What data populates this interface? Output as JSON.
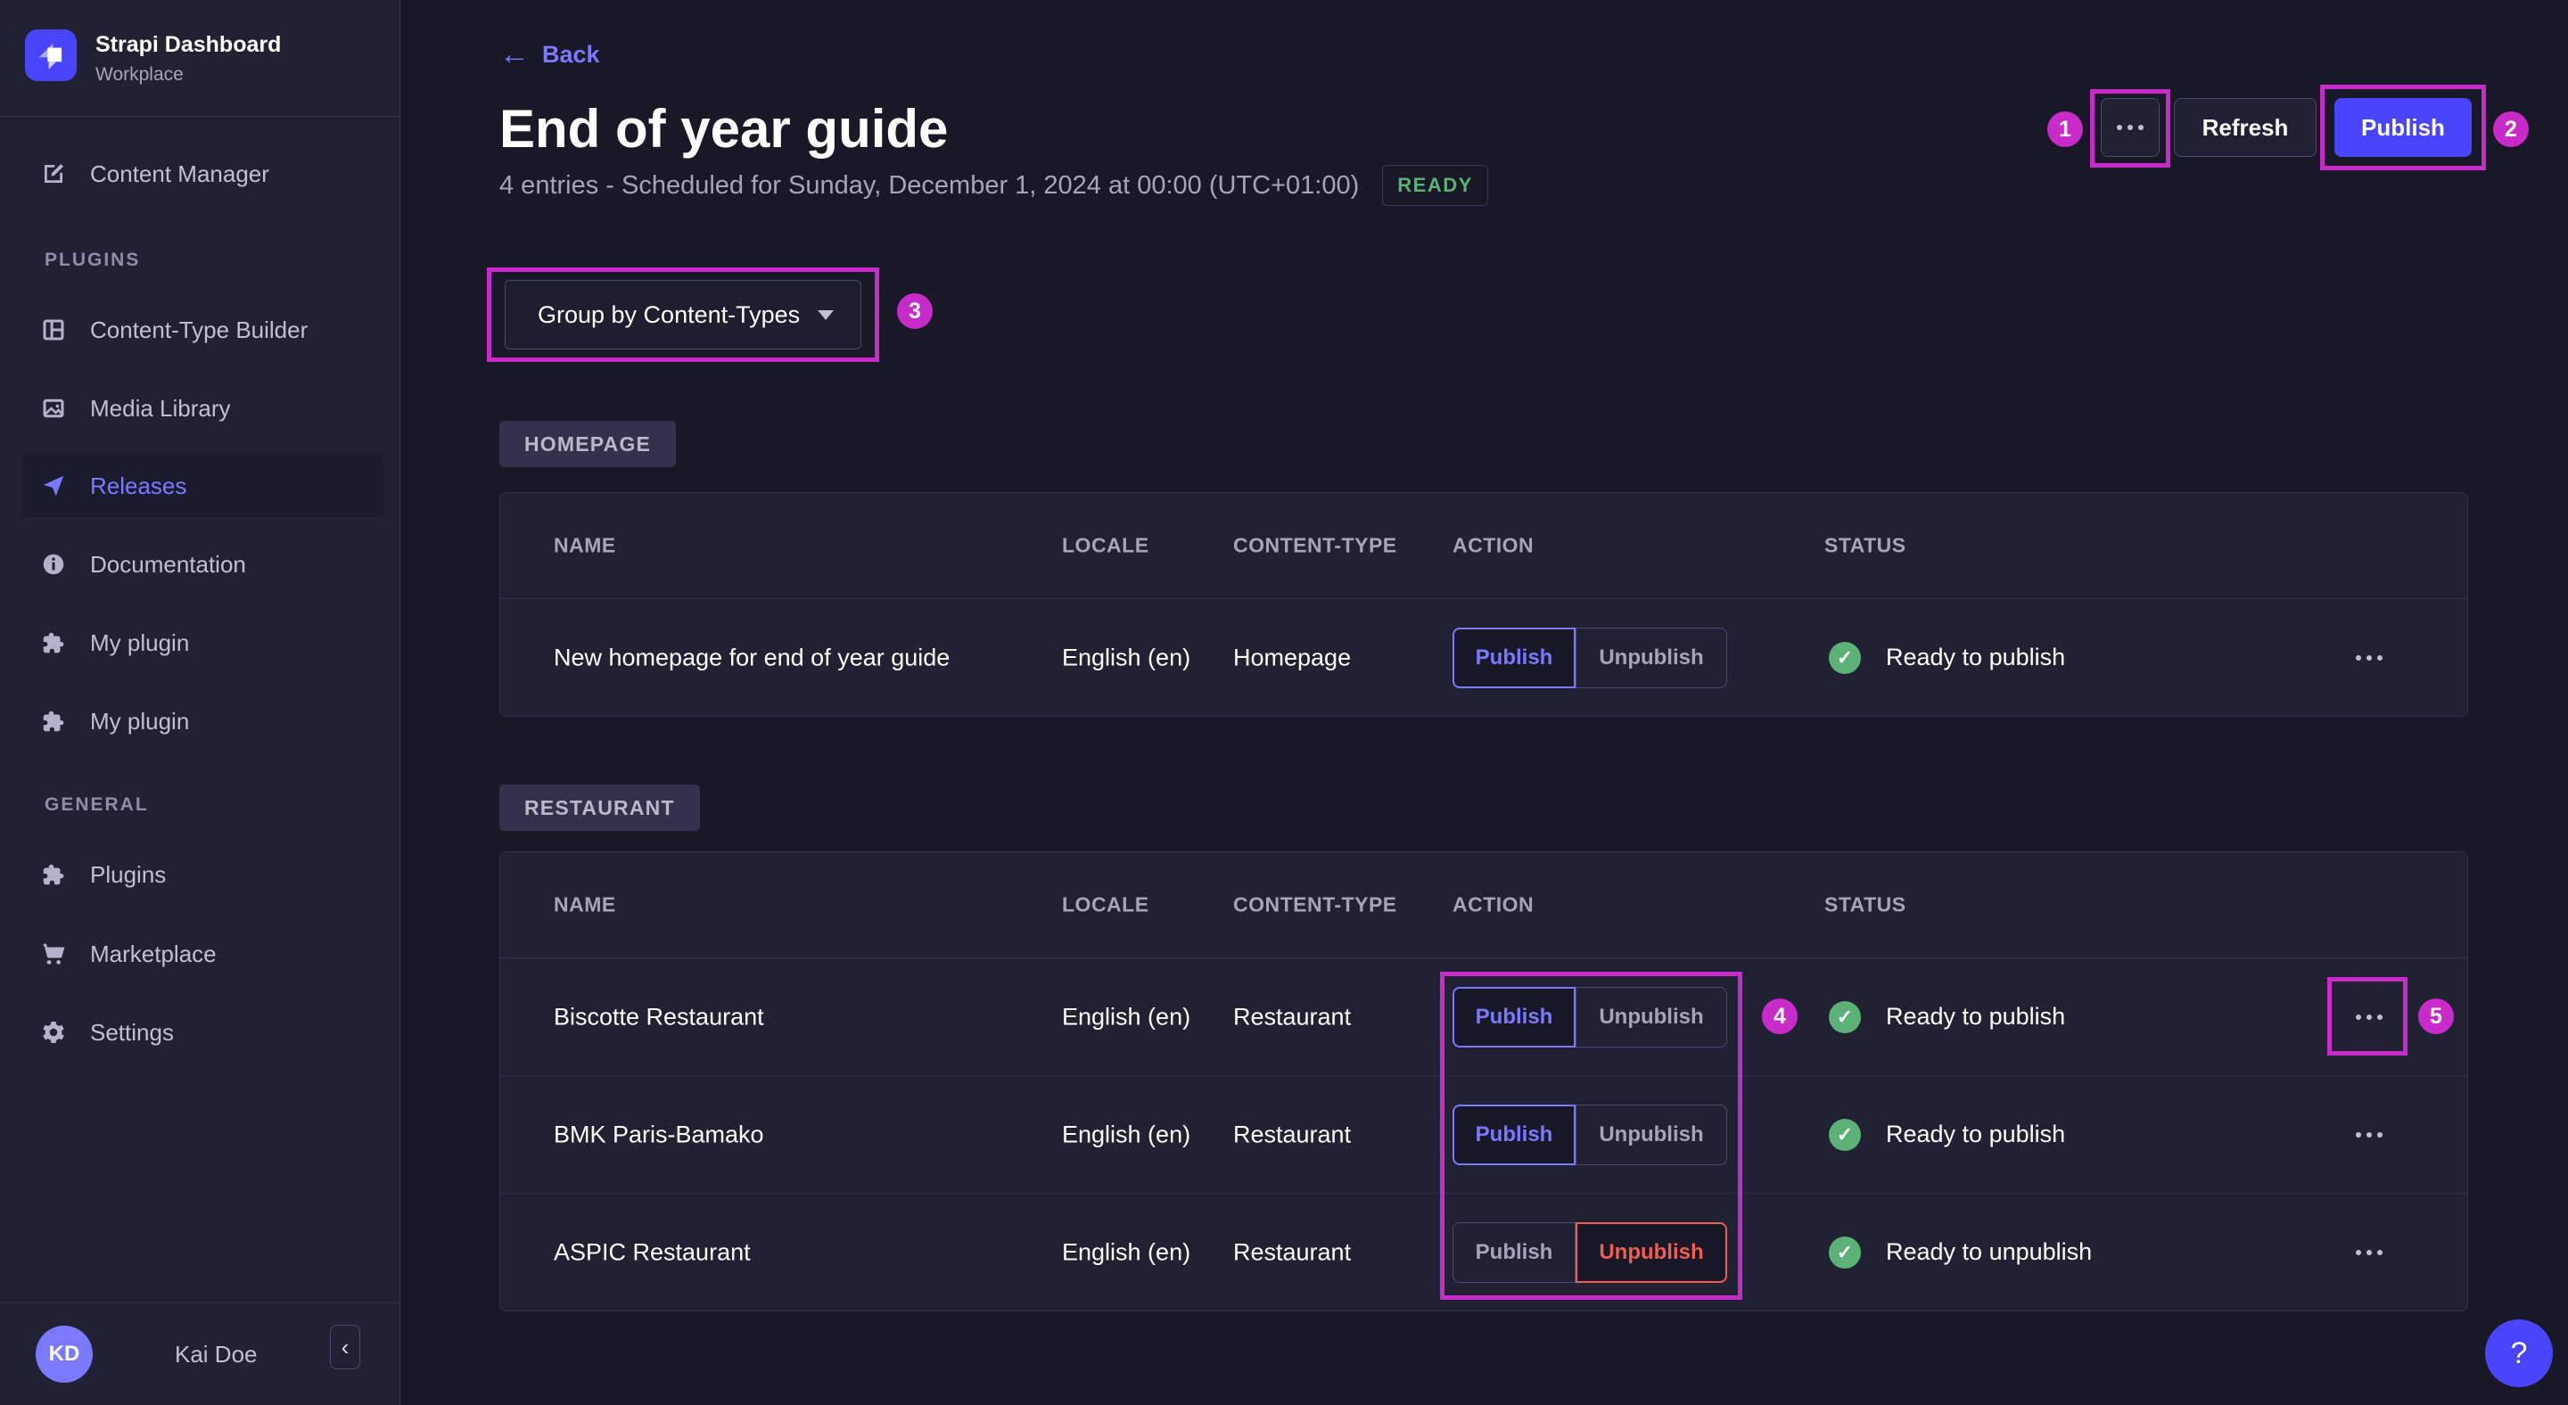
{
  "sidebar": {
    "app_title": "Strapi Dashboard",
    "app_subtitle": "Workplace",
    "main_items": [
      {
        "label": "Content Manager",
        "icon": "pencil-square-icon"
      }
    ],
    "sections": [
      {
        "heading": "PLUGINS",
        "items": [
          {
            "label": "Content-Type Builder",
            "icon": "layout-icon"
          },
          {
            "label": "Media Library",
            "icon": "image-icon"
          },
          {
            "label": "Releases",
            "icon": "paper-plane-icon",
            "active": true
          },
          {
            "label": "Documentation",
            "icon": "info-circle-icon"
          },
          {
            "label": "My plugin",
            "icon": "puzzle-icon"
          },
          {
            "label": "My plugin",
            "icon": "puzzle-icon"
          }
        ]
      },
      {
        "heading": "GENERAL",
        "items": [
          {
            "label": "Plugins",
            "icon": "puzzle-icon"
          },
          {
            "label": "Marketplace",
            "icon": "cart-icon"
          },
          {
            "label": "Settings",
            "icon": "gear-icon"
          }
        ]
      }
    ],
    "user": {
      "initials": "KD",
      "name": "Kai Doe"
    },
    "collapse_icon": "chevron-left-icon"
  },
  "header": {
    "back_label": "Back",
    "back_icon": "arrow-left-icon",
    "title": "End of year guide",
    "subtitle": "4 entries - Scheduled for Sunday, December 1, 2024 at 00:00 (UTC+01:00)",
    "badge": "READY",
    "more_icon": "ellipsis-icon",
    "refresh_label": "Refresh",
    "publish_label": "Publish"
  },
  "toolbar": {
    "group_by": "Group by Content-Types",
    "dropdown_icon": "chevron-down-icon"
  },
  "groups": [
    {
      "tag": "HOMEPAGE",
      "columns": [
        "NAME",
        "LOCALE",
        "CONTENT-TYPE",
        "ACTION",
        "STATUS"
      ],
      "rows": [
        {
          "name": "New homepage for end of year guide",
          "locale": "English (en)",
          "content_type": "Homepage",
          "actions": [
            "Publish",
            "Unpublish"
          ],
          "selected_action": "Publish",
          "status": "Ready to publish",
          "status_icon": "check-circle-icon",
          "row_menu_icon": "ellipsis-icon"
        }
      ]
    },
    {
      "tag": "RESTAURANT",
      "columns": [
        "NAME",
        "LOCALE",
        "CONTENT-TYPE",
        "ACTION",
        "STATUS"
      ],
      "rows": [
        {
          "name": "Biscotte Restaurant",
          "locale": "English (en)",
          "content_type": "Restaurant",
          "actions": [
            "Publish",
            "Unpublish"
          ],
          "selected_action": "Publish",
          "status": "Ready to publish",
          "status_icon": "check-circle-icon",
          "row_menu_icon": "ellipsis-icon"
        },
        {
          "name": "BMK Paris-Bamako",
          "locale": "English (en)",
          "content_type": "Restaurant",
          "actions": [
            "Publish",
            "Unpublish"
          ],
          "selected_action": "Publish",
          "status": "Ready to publish",
          "status_icon": "check-circle-icon",
          "row_menu_icon": "ellipsis-icon"
        },
        {
          "name": "ASPIC Restaurant",
          "locale": "English (en)",
          "content_type": "Restaurant",
          "actions": [
            "Publish",
            "Unpublish"
          ],
          "selected_action": "Unpublish",
          "status": "Ready to unpublish",
          "status_icon": "check-circle-icon",
          "row_menu_icon": "ellipsis-icon"
        }
      ]
    }
  ],
  "annotations": {
    "markers": [
      {
        "label": "1"
      },
      {
        "label": "2"
      },
      {
        "label": "3"
      },
      {
        "label": "4"
      },
      {
        "label": "5"
      }
    ]
  },
  "help": {
    "label": "?",
    "icon": "question-mark-icon"
  },
  "colors": {
    "background": "#181826",
    "surface": "#212134",
    "border": "#32324d",
    "border_light": "#4a4a6a",
    "accent": "#4945ff",
    "accent_light": "#7b79ff",
    "success": "#5cb176",
    "danger": "#ee5e52",
    "muted_text": "#a5a5ba",
    "annotation": "#c92aca"
  }
}
